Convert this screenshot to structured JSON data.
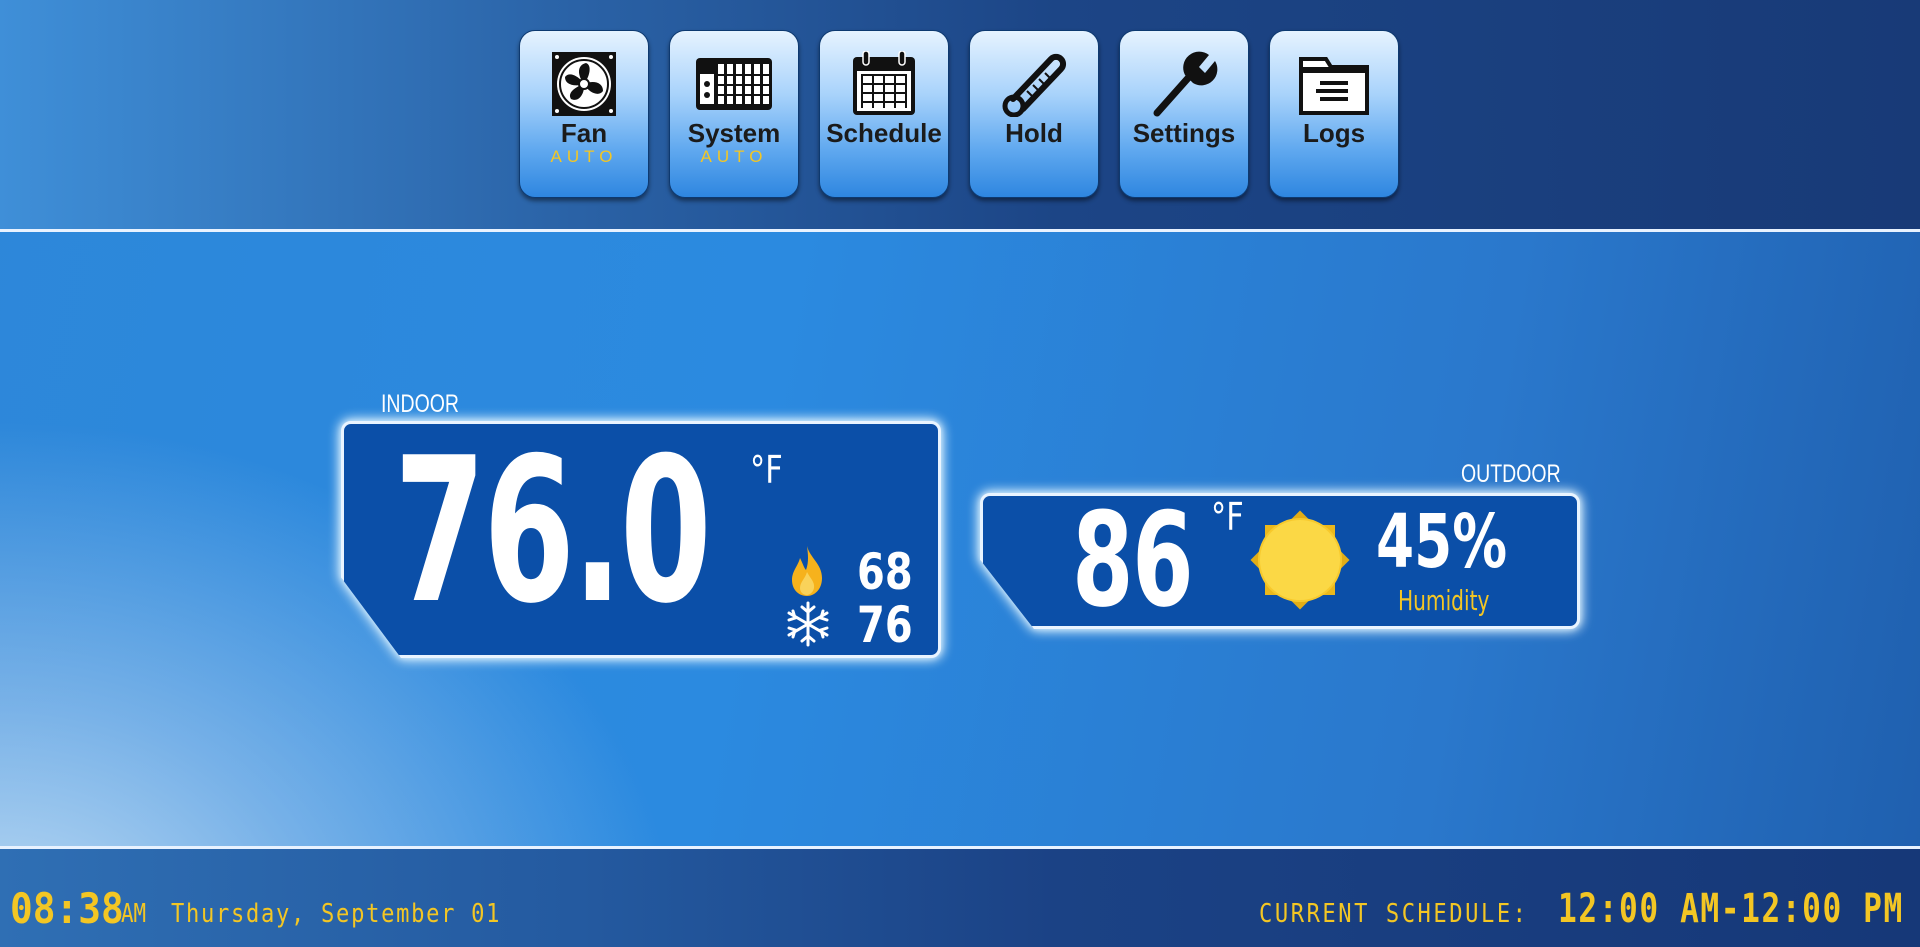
{
  "nav": {
    "fan": {
      "label": "Fan",
      "sub": "AUTO",
      "icon": "fan-icon"
    },
    "system": {
      "label": "System",
      "sub": "AUTO",
      "icon": "hvac-unit-icon"
    },
    "schedule": {
      "label": "Schedule",
      "icon": "calendar-icon"
    },
    "hold": {
      "label": "Hold",
      "icon": "thermometer-icon"
    },
    "settings": {
      "label": "Settings",
      "icon": "wrench-icon"
    },
    "logs": {
      "label": "Logs",
      "icon": "folder-icon"
    }
  },
  "indoor": {
    "label": "INDOOR",
    "temperature": "76.0",
    "unit": "°F",
    "heat_setpoint": "68",
    "cool_setpoint": "76",
    "heat_icon": "flame-icon",
    "cool_icon": "snowflake-icon"
  },
  "outdoor": {
    "label": "OUTDOOR",
    "temperature": "86",
    "unit": "°F",
    "condition_icon": "sun-icon",
    "humidity_value": "45%",
    "humidity_label": "Humidity"
  },
  "footer": {
    "time": "08:38",
    "ampm": "AM",
    "date": "Thursday, September 01",
    "schedule_label": "CURRENT SCHEDULE:",
    "schedule_value": "12:00 AM-12:00 PM"
  },
  "colors": {
    "accent_yellow": "#f3c624",
    "panel_blue": "#0b4fa8",
    "header_dark": "#183a77",
    "flame": "#f6b21c"
  }
}
